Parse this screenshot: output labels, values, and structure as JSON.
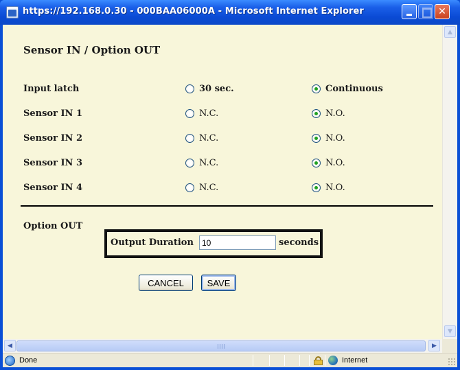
{
  "window": {
    "title": "https://192.168.0.30 - 000BAA06000A - Microsoft Internet Explorer"
  },
  "page": {
    "heading": "Sensor IN / Option OUT",
    "rows": [
      {
        "label": "Input latch",
        "option_a": "30 sec.",
        "option_b": "Continuous",
        "selected": "option_b"
      },
      {
        "label": "Sensor IN 1",
        "option_a": "N.C.",
        "option_b": "N.O.",
        "selected": "option_b"
      },
      {
        "label": "Sensor IN 2",
        "option_a": "N.C.",
        "option_b": "N.O.",
        "selected": "option_b"
      },
      {
        "label": "Sensor IN 3",
        "option_a": "N.C.",
        "option_b": "N.O.",
        "selected": "option_b"
      },
      {
        "label": "Sensor IN 4",
        "option_a": "N.C.",
        "option_b": "N.O.",
        "selected": "option_b"
      }
    ],
    "option_out": {
      "label": "Option OUT",
      "duration_label": "Output Duration",
      "duration_value": "10",
      "duration_unit": "seconds"
    },
    "buttons": {
      "cancel": "CANCEL",
      "save": "SAVE"
    }
  },
  "statusbar": {
    "status": "Done",
    "zone": "Internet"
  },
  "icons": {
    "window": "ie-page-icon",
    "close": "close-icon",
    "lock": "lock-icon",
    "zone": "globe-icon"
  },
  "colors": {
    "page_background": "#f8f6da",
    "titlebar": "#0a4ad4",
    "close_button": "#c9421e",
    "radio_checked": "#21a121"
  }
}
